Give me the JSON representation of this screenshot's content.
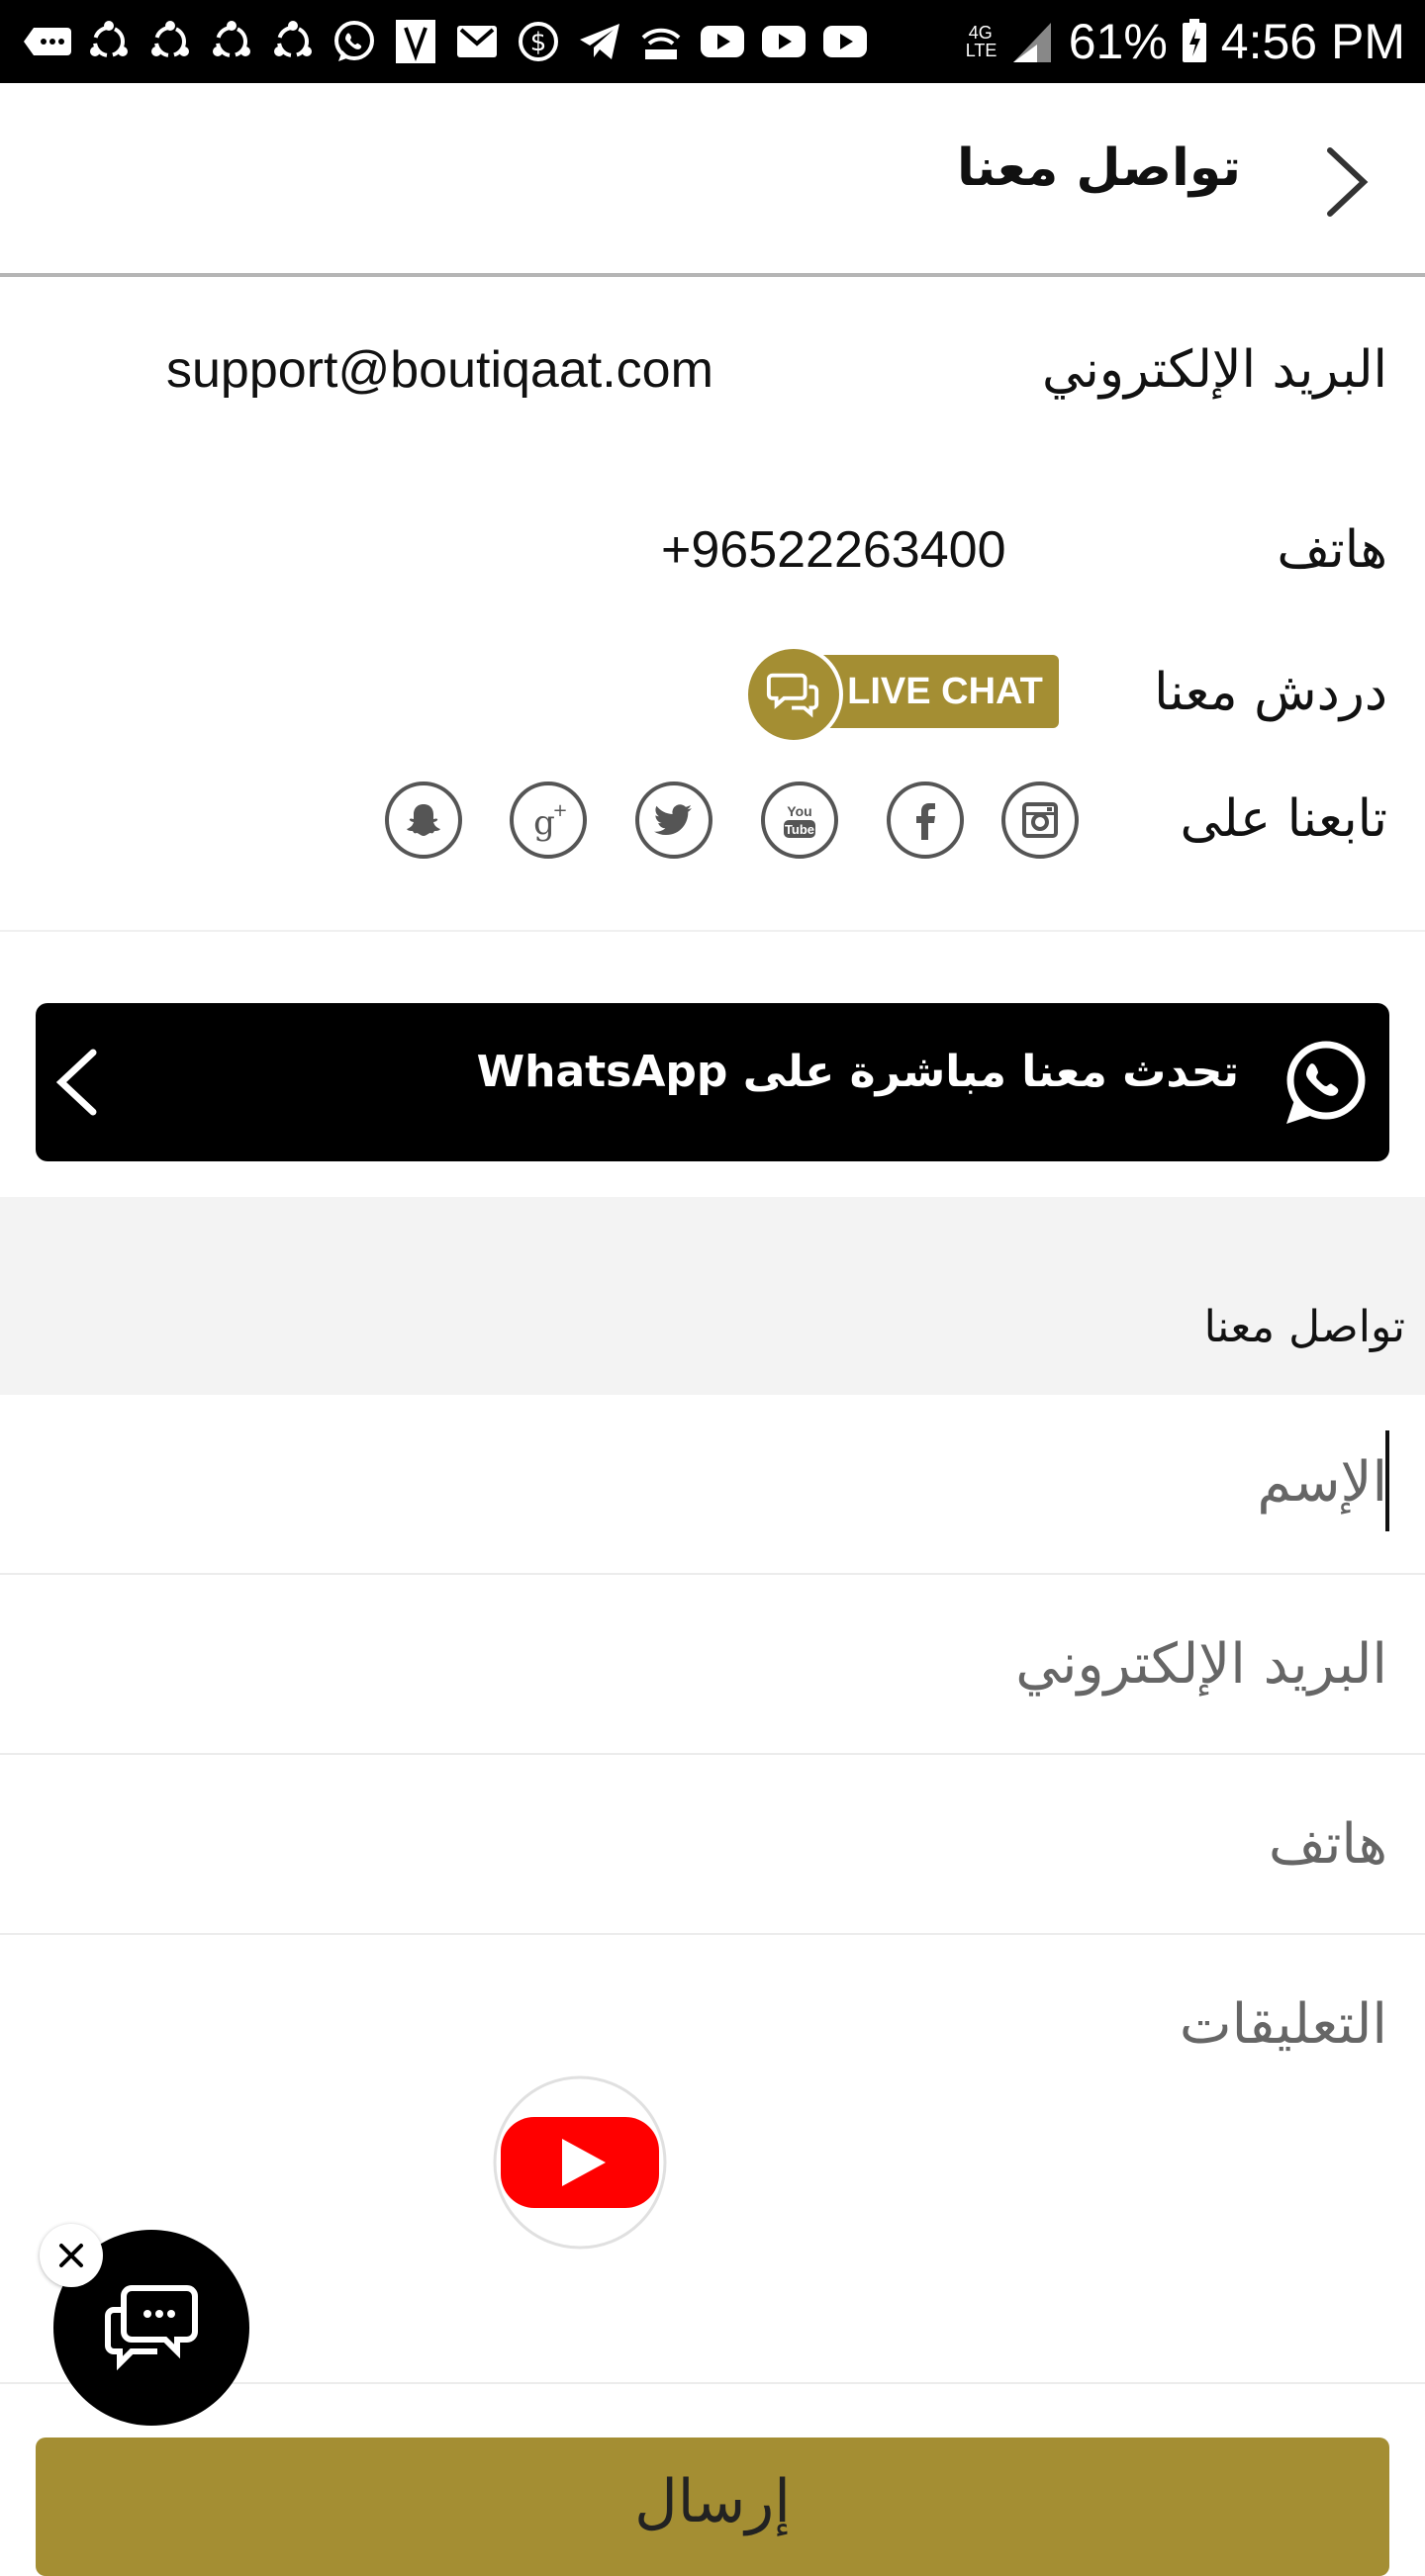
{
  "status_bar": {
    "battery": "61%",
    "time": "4:56 PM",
    "network": "4G LTE",
    "icons": [
      "more-icon",
      "sync-icon",
      "sync-icon",
      "sync-icon",
      "sync-icon",
      "whatsapp-icon",
      "vertu-icon",
      "gmail-icon",
      "dollar-icon",
      "telegram-icon",
      "cast-icon",
      "youtube-icon",
      "youtube-icon",
      "youtube-icon"
    ]
  },
  "header": {
    "title": "تواصل معنا"
  },
  "contact": {
    "email_label": "البريد الإلكتروني",
    "email_value": "support@boutiqaat.com",
    "phone_label": "هاتف",
    "phone_value": "+96522263400",
    "chat_label": "دردش معنا",
    "live_chat_label": "LIVE CHAT",
    "follow_label": "تابعنا على",
    "social": [
      "instagram-icon",
      "facebook-icon",
      "youtube-icon",
      "twitter-icon",
      "google-plus-icon",
      "snapchat-icon"
    ]
  },
  "whatsapp": {
    "label": "تحدث معنا مباشرة على WhatsApp"
  },
  "form": {
    "section_title": "تواصل معنا",
    "name_placeholder": "الإسم",
    "email_placeholder": "البريد الإلكتروني",
    "phone_placeholder": "هاتف",
    "comments_placeholder": "التعليقات",
    "submit_label": "إرسال"
  },
  "colors": {
    "accent": "#a48e33",
    "banner": "#000000",
    "youtube_red": "#ff0000"
  }
}
